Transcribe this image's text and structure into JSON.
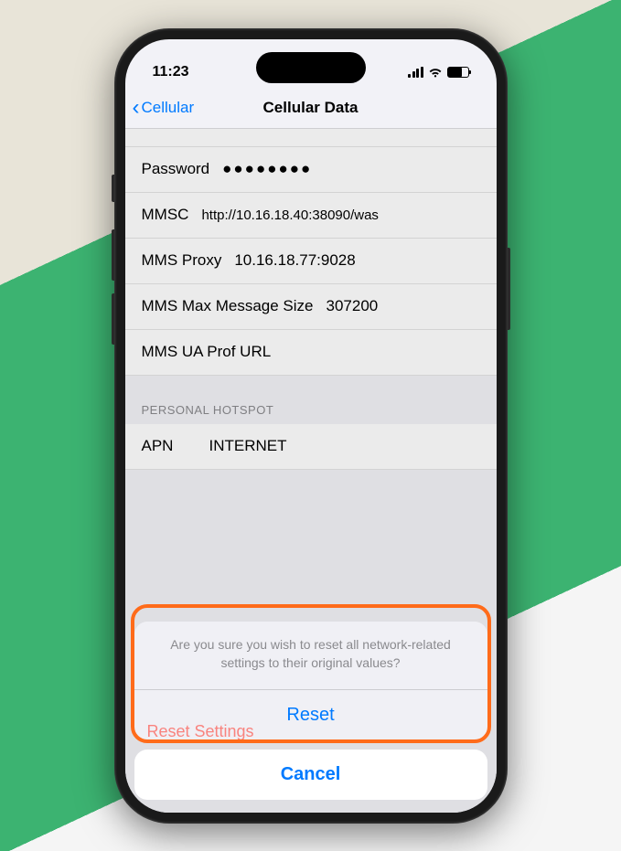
{
  "status": {
    "time": "11:23"
  },
  "nav": {
    "back": "Cellular",
    "title": "Cellular Data"
  },
  "fields": {
    "password_label": "Password",
    "password_value": "●●●●●●●●",
    "mmsc_label": "MMSC",
    "mmsc_value": "http://10.16.18.40:38090/was",
    "proxy_label": "MMS Proxy",
    "proxy_value": "10.16.18.77:9028",
    "maxsize_label": "MMS Max Message Size",
    "maxsize_value": "307200",
    "uaprof_label": "MMS UA Prof URL"
  },
  "hotspot": {
    "header": "PERSONAL HOTSPOT",
    "apn_label": "APN",
    "apn_value": "INTERNET"
  },
  "behind_button": "Reset Settings",
  "sheet": {
    "message": "Are you sure you wish to reset all network-related settings to their original values?",
    "reset": "Reset",
    "cancel": "Cancel"
  }
}
